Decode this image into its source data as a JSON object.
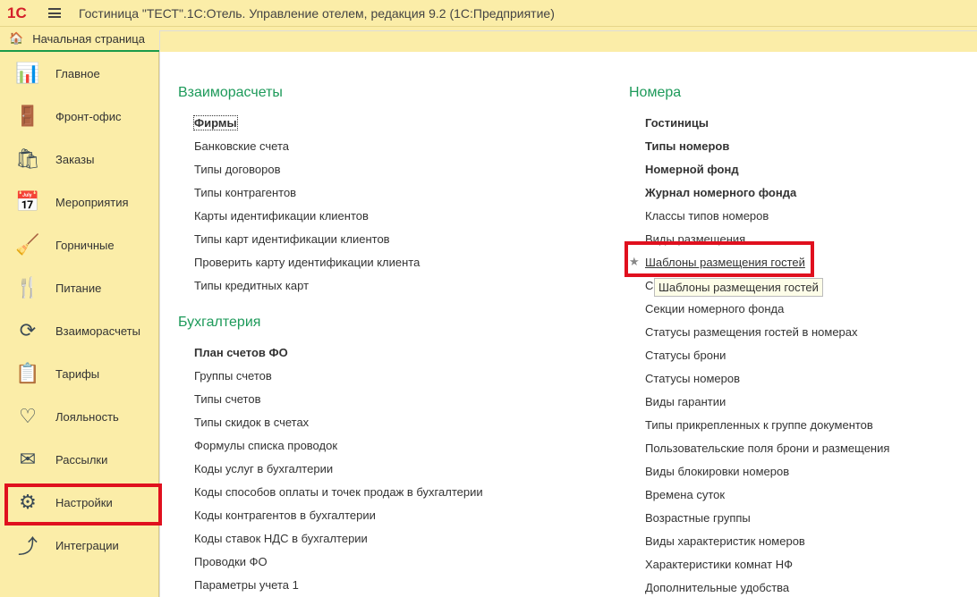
{
  "app": {
    "logo": "1С",
    "title": "Гостиница \"ТЕСТ\".1С:Отель. Управление отелем, редакция 9.2  (1С:Предприятие)",
    "home_tab": "Начальная страница"
  },
  "sidebar": {
    "items": [
      {
        "label": "Главное",
        "icon": "📊"
      },
      {
        "label": "Фронт-офис",
        "icon": "🚪"
      },
      {
        "label": "Заказы",
        "icon": "🛍"
      },
      {
        "label": "Мероприятия",
        "icon": "📅"
      },
      {
        "label": "Горничные",
        "icon": "🧹"
      },
      {
        "label": "Питание",
        "icon": "🍴"
      },
      {
        "label": "Взаиморасчеты",
        "icon": "⟳"
      },
      {
        "label": "Тарифы",
        "icon": "📋"
      },
      {
        "label": "Лояльность",
        "icon": "♡"
      },
      {
        "label": "Рассылки",
        "icon": "✉"
      },
      {
        "label": "Настройки",
        "icon": "⚙"
      },
      {
        "label": "Интеграции",
        "icon": "⤴"
      }
    ]
  },
  "left": {
    "sections": [
      {
        "title": "Взаиморасчеты",
        "links": [
          "Фирмы",
          "Банковские счета",
          "Типы договоров",
          "Типы контрагентов",
          "Карты идентификации клиентов",
          "Типы карт идентификации клиентов",
          "Проверить карту идентификации клиента",
          "Типы кредитных карт"
        ]
      },
      {
        "title": "Бухгалтерия",
        "links": [
          "План счетов ФО",
          "Группы счетов",
          "Типы счетов",
          "Типы скидок в счетах",
          "Формулы списка проводок",
          "Коды услуг в бухгалтерии",
          "Коды способов оплаты и точек продаж в бухгалтерии",
          "Коды контрагентов в бухгалтерии",
          "Коды ставок НДС в бухгалтерии",
          "Проводки ФО",
          "Параметры учета 1"
        ]
      }
    ]
  },
  "right": {
    "title": "Номера",
    "links": [
      "Гостиницы",
      "Типы номеров",
      "Номерной фонд",
      "Журнал номерного фонда",
      "Классы типов номеров",
      "Виды размещения",
      "Шаблоны размещения гостей",
      "С",
      "Секции номерного фонда",
      "Статусы размещения гостей в номерах",
      "Статусы брони",
      "Статусы номеров",
      "Виды гарантии",
      "Типы прикрепленных к группе документов",
      "Пользовательские поля брони и размещения",
      "Виды блокировки номеров",
      "Времена суток",
      "Возрастные группы",
      "Виды характеристик номеров",
      "Характеристики комнат НФ",
      "Дополнительные удобства"
    ]
  },
  "tooltip": "Шаблоны размещения гостей"
}
